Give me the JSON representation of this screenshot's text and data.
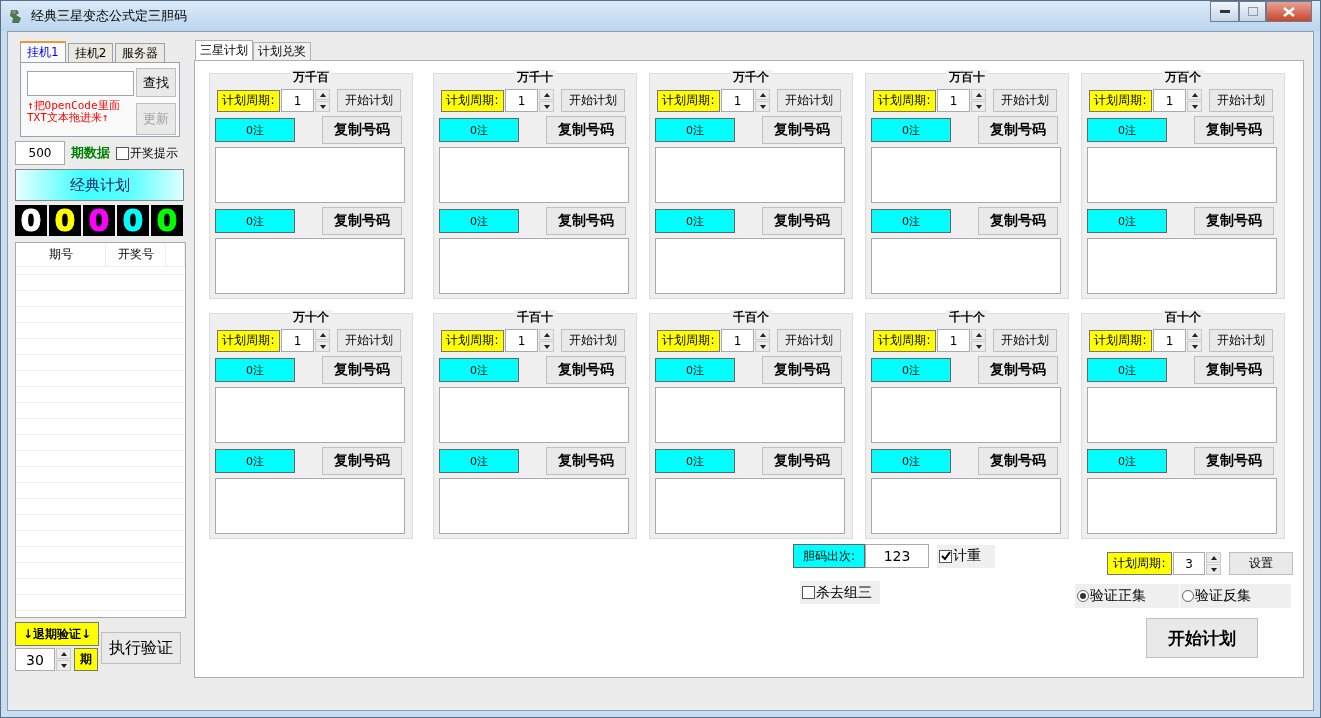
{
  "window": {
    "title": "经典三星变态公式定三胆码"
  },
  "left_tabs": [
    {
      "label": "挂机1",
      "selected": true
    },
    {
      "label": "挂机2",
      "selected": false
    },
    {
      "label": "服务器",
      "selected": false
    }
  ],
  "find_button": "查找",
  "drop_hint": [
    "↑把OpenCode里面",
    "TXT文本拖进来↑"
  ],
  "update_button": {
    "label": "更新",
    "disabled": true
  },
  "period_count": "500",
  "period_label": "期数据",
  "draw_alert": {
    "label": "开奖提示",
    "checked": false
  },
  "classic_plan_button": "经典计划",
  "digits": [
    {
      "text": "0",
      "color": "#ffffff"
    },
    {
      "text": "0",
      "color": "#ffff00"
    },
    {
      "text": "0",
      "color": "#ff00ff"
    },
    {
      "text": "0",
      "color": "#00ffff"
    },
    {
      "text": "0",
      "color": "#00ff00"
    }
  ],
  "history_table": {
    "columns": [
      "期号",
      "开奖号"
    ]
  },
  "backtest_label": "↓退期验证↓",
  "backtest_periods": "30",
  "backtest_unit": "期",
  "run_verify_button": "执行验证",
  "main_tabs": [
    {
      "label": "三星计划",
      "selected": true
    },
    {
      "label": "计划兑奖",
      "selected": false
    }
  ],
  "plans": [
    {
      "title": "万千百",
      "period_label": "计划周期:",
      "period": "1",
      "start_button": "开始计划",
      "groups": [
        {
          "count": "0注",
          "copy_button": "复制号码"
        },
        {
          "count": "0注",
          "copy_button": "复制号码"
        }
      ]
    },
    {
      "title": "万千十",
      "period_label": "计划周期:",
      "period": "1",
      "start_button": "开始计划",
      "groups": [
        {
          "count": "0注",
          "copy_button": "复制号码"
        },
        {
          "count": "0注",
          "copy_button": "复制号码"
        }
      ]
    },
    {
      "title": "万千个",
      "period_label": "计划周期:",
      "period": "1",
      "start_button": "开始计划",
      "groups": [
        {
          "count": "0注",
          "copy_button": "复制号码"
        },
        {
          "count": "0注",
          "copy_button": "复制号码"
        }
      ]
    },
    {
      "title": "万百十",
      "period_label": "计划周期:",
      "period": "1",
      "start_button": "开始计划",
      "groups": [
        {
          "count": "0注",
          "copy_button": "复制号码"
        },
        {
          "count": "0注",
          "copy_button": "复制号码"
        }
      ]
    },
    {
      "title": "万百个",
      "period_label": "计划周期:",
      "period": "1",
      "start_button": "开始计划",
      "groups": [
        {
          "count": "0注",
          "copy_button": "复制号码"
        },
        {
          "count": "0注",
          "copy_button": "复制号码"
        }
      ]
    },
    {
      "title": "万十个",
      "period_label": "计划周期:",
      "period": "1",
      "start_button": "开始计划",
      "groups": [
        {
          "count": "0注",
          "copy_button": "复制号码"
        },
        {
          "count": "0注",
          "copy_button": "复制号码"
        }
      ]
    },
    {
      "title": "千百十",
      "period_label": "计划周期:",
      "period": "1",
      "start_button": "开始计划",
      "groups": [
        {
          "count": "0注",
          "copy_button": "复制号码"
        },
        {
          "count": "0注",
          "copy_button": "复制号码"
        }
      ]
    },
    {
      "title": "千百个",
      "period_label": "计划周期:",
      "period": "1",
      "start_button": "开始计划",
      "groups": [
        {
          "count": "0注",
          "copy_button": "复制号码"
        },
        {
          "count": "0注",
          "copy_button": "复制号码"
        }
      ]
    },
    {
      "title": "千十个",
      "period_label": "计划周期:",
      "period": "1",
      "start_button": "开始计划",
      "groups": [
        {
          "count": "0注",
          "copy_button": "复制号码"
        },
        {
          "count": "0注",
          "copy_button": "复制号码"
        }
      ]
    },
    {
      "title": "百十个",
      "period_label": "计划周期:",
      "period": "1",
      "start_button": "开始计划",
      "groups": [
        {
          "count": "0注",
          "copy_button": "复制号码"
        },
        {
          "count": "0注",
          "copy_button": "复制号码"
        }
      ]
    }
  ],
  "settings": {
    "dan_label": "胆码出次:",
    "dan_value": "123",
    "count_repeat": {
      "label": "计重",
      "checked": true
    },
    "kill_pair": {
      "label": "杀去组三",
      "checked": false
    },
    "period_label": "计划周期:",
    "period": "3",
    "set_button": "设置",
    "verify_modes": [
      {
        "label": "验证正集",
        "selected": true
      },
      {
        "label": "验证反集",
        "selected": false
      }
    ],
    "start_button": "开始计划"
  }
}
